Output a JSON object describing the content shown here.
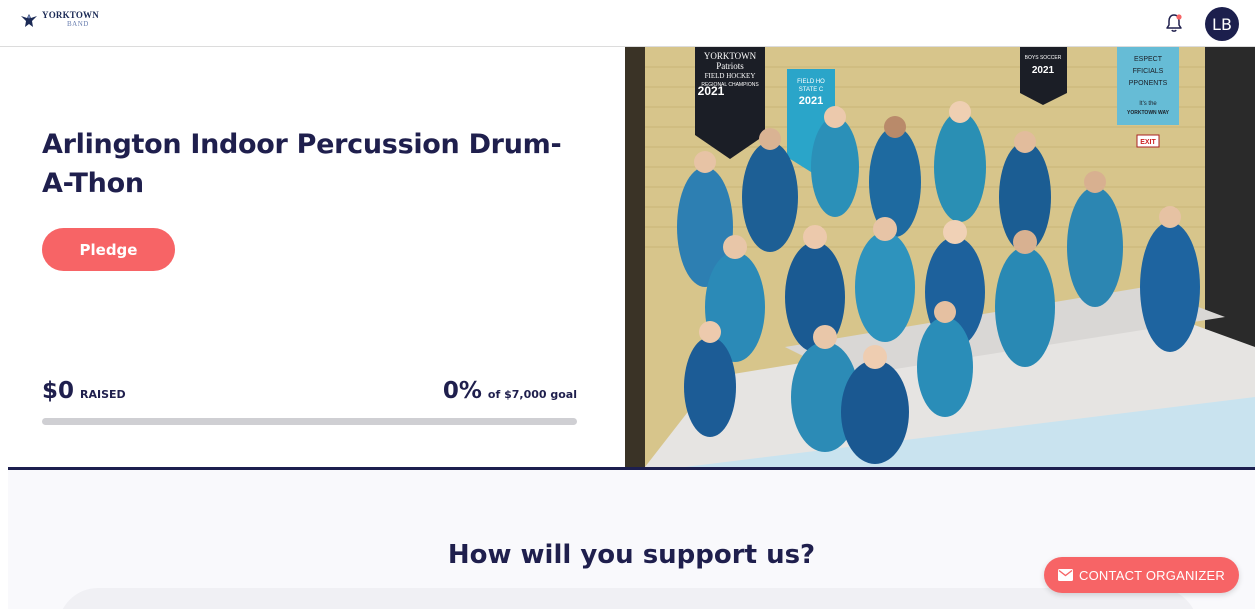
{
  "header": {
    "logo_line1": "YORKTOWN",
    "logo_line2": "BAND",
    "avatar_initials": "LB"
  },
  "campaign": {
    "title": "Arlington Indoor Percussion Drum-A-Thon",
    "pledge_label": "Pledge",
    "raised_amount": "$0",
    "raised_label": "RAISED",
    "percent": "0%",
    "goal_text": "of $7,000 goal",
    "progress": 0
  },
  "photo_banners": {
    "banner1_line1": "YORKTOWN",
    "banner1_line2": "Patriots",
    "banner1_line3": "FIELD HOCKEY",
    "banner1_line4": "REGIONAL CHAMPIONS",
    "banner1_year": "2021",
    "banner2_line1": "FIELD HO",
    "banner2_line2": "STATE C",
    "banner2_year": "2021",
    "banner3_line1": "BOYS SOCCER",
    "banner3_year": "2021",
    "banner4_line1": "ESPECT",
    "banner4_line2": "FFICIALS",
    "banner4_line3": "PPONENTS",
    "banner4_line4": "It's the",
    "banner4_line5": "YORKTOWN WAY",
    "exit_sign": "EXIT"
  },
  "support": {
    "heading": "How will you support us?"
  },
  "contact": {
    "label": "CONTACT ORGANIZER"
  },
  "colors": {
    "navy": "#1f1f4d",
    "coral": "#f76466",
    "track": "#cfcfd3"
  }
}
